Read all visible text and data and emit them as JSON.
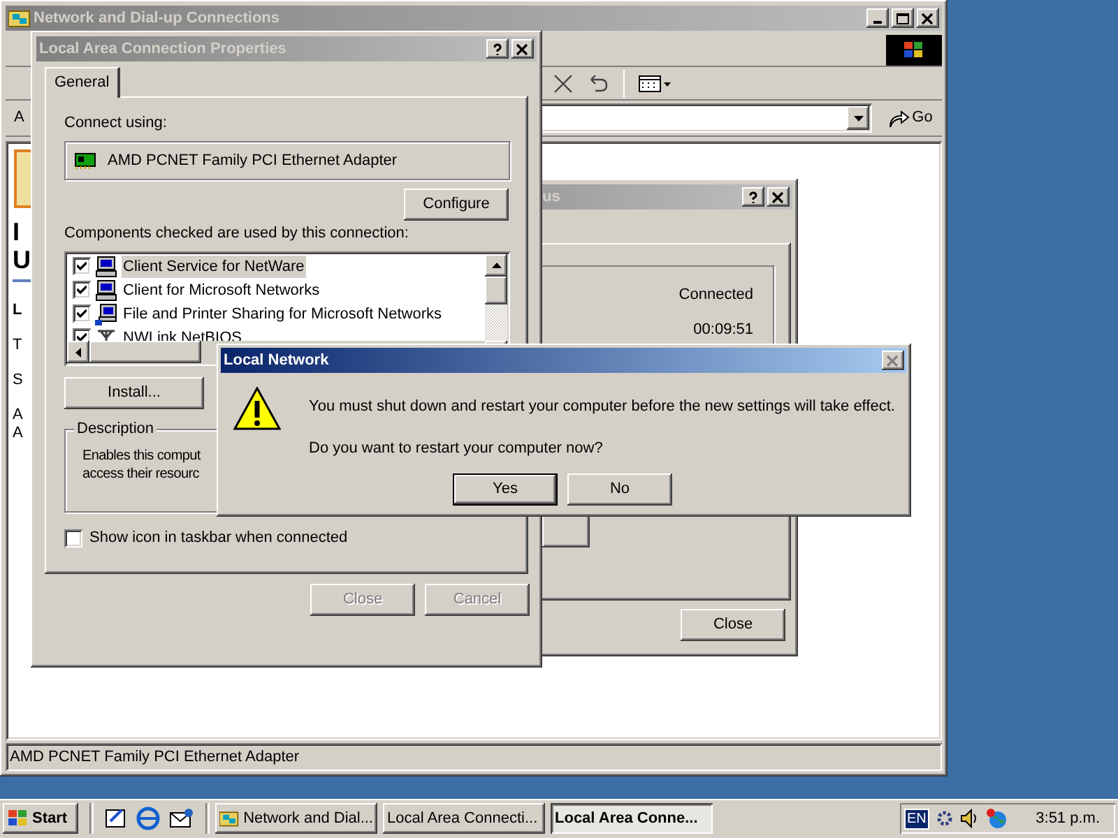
{
  "explorer": {
    "title": "Network and Dial-up Connections",
    "active": false,
    "address_label": "A",
    "go_button": "Go",
    "heading_fragments": [
      "I",
      "U"
    ],
    "left_pane_fragments": [
      "L",
      "T",
      "S",
      "A",
      "A"
    ],
    "status_bar": "AMD PCNET Family PCI Ethernet Adapter"
  },
  "status_dialog": {
    "title": "us",
    "active": false,
    "status": "Connected",
    "duration": "00:09:51",
    "close_button": "Close"
  },
  "properties": {
    "title": "Local Area Connection Properties",
    "active": false,
    "tabs": [
      {
        "label": "General",
        "selected": true
      }
    ],
    "connect_using_label": "Connect using:",
    "adapter": "AMD PCNET Family PCI Ethernet Adapter",
    "configure_button": "Configure",
    "components_label": "Components checked are used by this connection:",
    "components": [
      {
        "name": "Client Service for NetWare",
        "kind": "client",
        "checked": true,
        "selected": true
      },
      {
        "name": "Client for Microsoft Networks",
        "kind": "client",
        "checked": true,
        "selected": false
      },
      {
        "name": "File and Printer Sharing for Microsoft Networks",
        "kind": "service",
        "checked": true,
        "selected": false
      },
      {
        "name": "NWLink NetBIOS",
        "kind": "protocol",
        "checked": true,
        "selected": false
      }
    ],
    "install_button": "Install...",
    "description_title": "Description",
    "description_lines": [
      "Enables this comput",
      "access their resourc"
    ],
    "show_icon_checkbox": {
      "label": "Show icon in taskbar when connected",
      "checked": false
    },
    "buttons": [
      {
        "label": "Close",
        "disabled": true
      },
      {
        "label": "Cancel",
        "disabled": true
      }
    ]
  },
  "message_box": {
    "title": "Local Network",
    "active": true,
    "message": "You must shut down and restart your computer before the new settings will take effect.",
    "question": "Do you want to restart your computer now?",
    "buttons": [
      {
        "label": "Yes",
        "default": true
      },
      {
        "label": "No",
        "default": false
      }
    ]
  },
  "taskbar": {
    "start": "Start",
    "tasks": [
      {
        "label": "Network and Dial...",
        "selected": false
      },
      {
        "label": "Local Area Connecti...",
        "selected": false
      },
      {
        "label": "Local Area Conne...",
        "selected": true
      }
    ],
    "language": "EN",
    "clock": "3:51 p.m."
  }
}
